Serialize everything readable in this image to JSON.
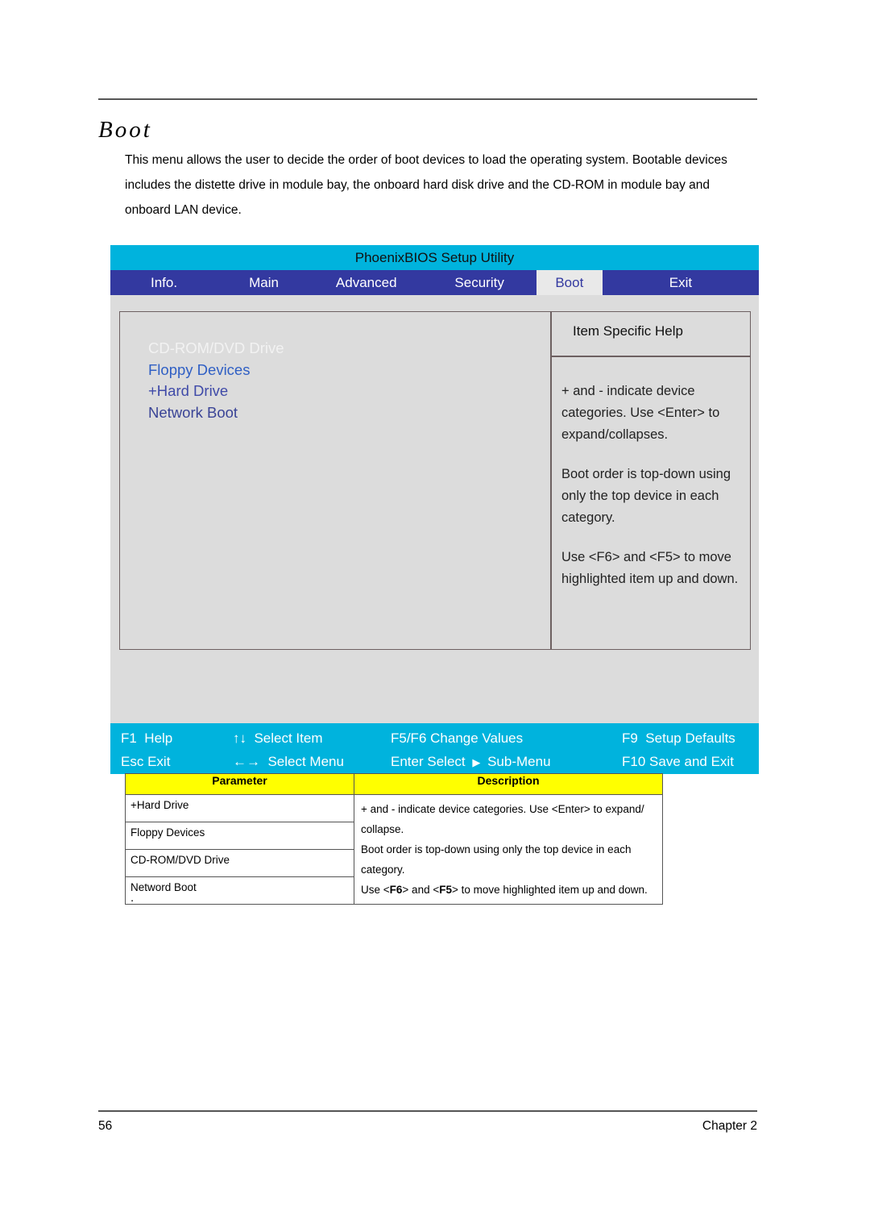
{
  "page": {
    "section_title": "Boot",
    "intro": "This menu allows the user to decide the order of boot devices to load the operating system. Bootable devices includes the distette drive in module bay, the onboard hard disk drive and the CD-ROM in module bay and onboard LAN device.",
    "footer_page_number": "56",
    "footer_chapter": "Chapter 2",
    "stray_mark": "."
  },
  "bios": {
    "title": "PhoenixBIOS Setup Utility",
    "colors": {
      "title_bar": "#00b3dd",
      "tab_bar": "#3339a0",
      "active_tab_bg": "#e9e9e9",
      "active_tab_text": "#3339a0",
      "body_bg": "#dcdcdc",
      "key_bar": "#00b3dd"
    },
    "tabs": [
      {
        "label": "Info.",
        "active": false
      },
      {
        "label": "Main",
        "active": false
      },
      {
        "label": "Advanced",
        "active": false
      },
      {
        "label": "Security",
        "active": false
      },
      {
        "label": "Boot",
        "active": true
      },
      {
        "label": "Exit",
        "active": false
      }
    ],
    "boot_devices": [
      {
        "label": "CD-ROM/DVD Drive",
        "state": "selected"
      },
      {
        "label": "Floppy Devices",
        "state": "normal"
      },
      {
        "label": "+Hard Drive",
        "state": "normal"
      },
      {
        "label": "Network Boot",
        "state": "normal"
      }
    ],
    "help": {
      "title": "Item Specific Help",
      "paragraphs": [
        "+ and - indicate device categories. Use  <Enter> to expand/collapses.",
        "Boot order is top-down using only the top device in each category.",
        "Use <F6> and <F5> to move highlighted item up and down."
      ]
    },
    "keys": {
      "row1": [
        {
          "key": "F1",
          "label": "Help"
        },
        {
          "key": "↑↓",
          "label": "Select Item"
        },
        {
          "key": "F5/F6",
          "label": "Change Values"
        },
        {
          "key": "F9",
          "label": "Setup Defaults"
        }
      ],
      "row2": [
        {
          "key": "Esc",
          "label": "Exit"
        },
        {
          "key": "←→",
          "label": "Select Menu"
        },
        {
          "key": "Enter",
          "label": "Select"
        },
        {
          "key": "F10",
          "label": "Save and Exit"
        }
      ],
      "submenu_label": "Sub-Menu",
      "submenu_arrow": "▶"
    }
  },
  "param_table": {
    "headers": [
      "Parameter",
      "Description"
    ],
    "parameters": [
      "+Hard Drive",
      "Floppy Devices",
      "CD-ROM/DVD Drive",
      "Netword Boot"
    ],
    "description_lines": [
      "+ and - indicate device categories. Use <Enter> to expand/collapse.",
      "Boot order is top-down using only the top device in each category.",
      "Use <F6> and <F5> to move highlighted item up and down."
    ],
    "description_parts": {
      "p1": "+ and - indicate device categories. Use <Enter> to expand/",
      "p2": "collapse.",
      "p3": "Boot order is top-down using only the top device in each",
      "p4": "category.",
      "p5a": "Use <",
      "p5b": "F6",
      "p5c": "> and <",
      "p5d": "F5",
      "p5e": "> to move highlighted item up and down."
    }
  }
}
